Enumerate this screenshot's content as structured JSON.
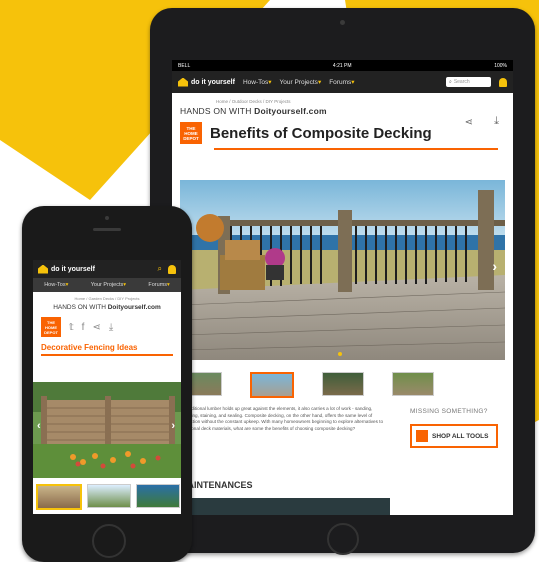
{
  "colors": {
    "brand_yellow": "#f6c20b",
    "home_depot_orange": "#f96302",
    "nav_dark": "#222222"
  },
  "ipad": {
    "status": {
      "carrier": "BELL",
      "time": "4:21 PM",
      "battery": "100%"
    },
    "nav": {
      "logo": "do it yourself",
      "items": [
        "How-Tos",
        "Your Projects",
        "Forums"
      ],
      "search_placeholder": "Search"
    },
    "breadcrumb": "Home / Outdoor Decks / DIY Projects",
    "hands_on_prefix": "HANDS ON WITH ",
    "hands_on_site": "Doityourself.com",
    "home_depot_badge": "THE HOME DEPOT",
    "title": "Benefits of Composite Decking",
    "body_text": "…Traditional lumber holds up great against the elements, it also carries a lot of work - sanding, trimming, staining, and sealing. Composite decking, on the other hand, offers the same level of protection without the constant upkeep. With many homeowners beginning to explore alternatives to traditional deck materials, what are some the benefits of choosing composite decking?",
    "missing": "MISSING SOMETHING?",
    "shop_all": "SHOP ALL TOOLS",
    "section": "MAINTENANCES",
    "icons": [
      "share-icon",
      "download-icon",
      "search-icon",
      "user-icon",
      "chevron-right-icon"
    ]
  },
  "iphone": {
    "logo": "do it yourself",
    "menu": [
      "How-Tos",
      "Your Projects",
      "Forums"
    ],
    "breadcrumb": "Home / Garden Decks / DIY Projects",
    "hands_on_prefix": "HANDS ON WITH ",
    "hands_on_site": "Doityourself.com",
    "home_depot_badge": "THE HOME DEPOT",
    "title": "Decorative Fencing Ideas",
    "icons": [
      "twitter-icon",
      "facebook-icon",
      "share-icon",
      "download-icon",
      "search-icon",
      "user-icon",
      "chevron-left-icon",
      "chevron-right-icon"
    ]
  }
}
